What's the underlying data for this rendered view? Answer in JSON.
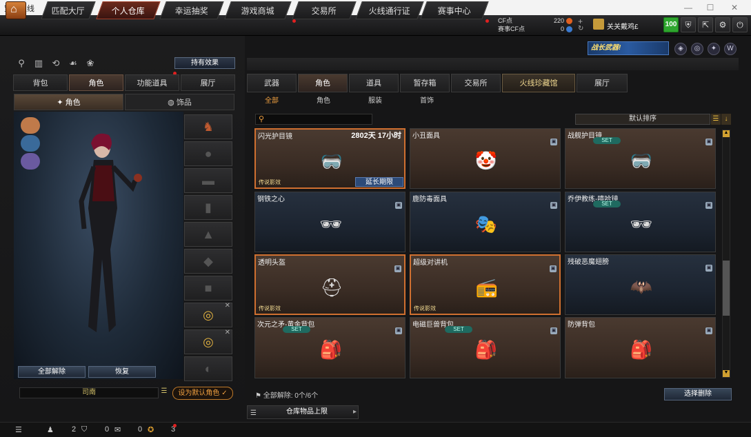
{
  "window": {
    "title": "穿越火线"
  },
  "nav": {
    "tabs": [
      "匹配大厅",
      "个人仓库",
      "幸运抽奖",
      "游戏商城",
      "交易所",
      "火线通行证",
      "赛事中心"
    ],
    "active_index": 1
  },
  "currency": {
    "cf_label": "CF点",
    "cf_value": "220",
    "event_label": "赛事CF点",
    "event_value": "0"
  },
  "user": {
    "name": "关关戴鸡£",
    "level": "100"
  },
  "banner": {
    "text": "战长武器!"
  },
  "left": {
    "effect_button": "持有效果",
    "tabs": [
      "背包",
      "角色",
      "功能道具",
      "展厅"
    ],
    "active_tab": 1,
    "subtabs": [
      "角色",
      "饰品"
    ],
    "active_subtab": 0,
    "release_all": "全部解除",
    "restore": "恢复",
    "character_name": "司南",
    "set_default": "设为默认角色"
  },
  "right": {
    "tabs": [
      "武器",
      "角色",
      "道具",
      "暂存箱",
      "交易所",
      "火线珍藏馆",
      "展厅"
    ],
    "active_tab": 1,
    "subtabs": [
      "全部",
      "角色",
      "服装",
      "首饰"
    ],
    "active_subtab": 0,
    "search_placeholder": "",
    "sort_label": "默认排序",
    "items": [
      {
        "name": "闪光护目镜",
        "time": "2802天 17小时",
        "legend": "传说影效",
        "extend": "延长期限",
        "set": "",
        "rarity": "r1",
        "selected": true,
        "icon": "goggles-icon",
        "glyph": "🥽"
      },
      {
        "name": "小丑面具",
        "time": "",
        "legend": "",
        "extend": "",
        "set": "",
        "rarity": "r1",
        "selected": false,
        "icon": "clown-mask-icon",
        "glyph": "🤡"
      },
      {
        "name": "战舰护目镜",
        "time": "",
        "legend": "",
        "extend": "",
        "set": "SET",
        "rarity": "r1",
        "selected": false,
        "icon": "visor-icon",
        "glyph": "🥽"
      },
      {
        "name": "钢铁之心",
        "time": "",
        "legend": "",
        "extend": "",
        "set": "",
        "rarity": "r2",
        "selected": false,
        "icon": "sunglasses-icon",
        "glyph": "🕶"
      },
      {
        "name": "鹿防毒面具",
        "time": "",
        "legend": "",
        "extend": "",
        "set": "",
        "rarity": "r2",
        "selected": false,
        "icon": "gas-mask-icon",
        "glyph": "🎭"
      },
      {
        "name": "乔伊教练-嘻哈镜",
        "time": "",
        "legend": "",
        "extend": "",
        "set": "SET",
        "rarity": "r2",
        "selected": false,
        "icon": "shutter-glasses-icon",
        "glyph": "🕶"
      },
      {
        "name": "透明头盔",
        "time": "",
        "legend": "传说影效",
        "extend": "",
        "set": "",
        "rarity": "r1",
        "selected": true,
        "icon": "helmet-icon",
        "glyph": "⛑"
      },
      {
        "name": "超级对讲机",
        "time": "",
        "legend": "传说影效",
        "extend": "",
        "set": "",
        "rarity": "r1",
        "selected": true,
        "icon": "walkie-talkie-icon",
        "glyph": "📻"
      },
      {
        "name": "残破恶魔翅膀",
        "time": "",
        "legend": "",
        "extend": "",
        "set": "",
        "rarity": "r2",
        "selected": false,
        "icon": "demon-wings-icon",
        "glyph": "🦇"
      },
      {
        "name": "次元之矛-黄金背包",
        "time": "",
        "legend": "",
        "extend": "",
        "set": "SET",
        "rarity": "r1",
        "selected": false,
        "icon": "golden-backpack-icon",
        "glyph": "🎒"
      },
      {
        "name": "电磁巨兽背包",
        "time": "",
        "legend": "",
        "extend": "",
        "set": "SET",
        "rarity": "r1",
        "selected": false,
        "icon": "electro-backpack-icon",
        "glyph": "🎒"
      },
      {
        "name": "防弹背包",
        "time": "",
        "legend": "",
        "extend": "",
        "set": "",
        "rarity": "r1",
        "selected": false,
        "icon": "armor-backpack-icon",
        "glyph": "🎒"
      }
    ],
    "release_info": "全部解除: 0个/6个",
    "select_remove": "选择删除",
    "capacity_label": "仓库物品上限"
  },
  "status": {
    "count1": "2",
    "count2": "0",
    "count3": "0",
    "count4": "3"
  }
}
